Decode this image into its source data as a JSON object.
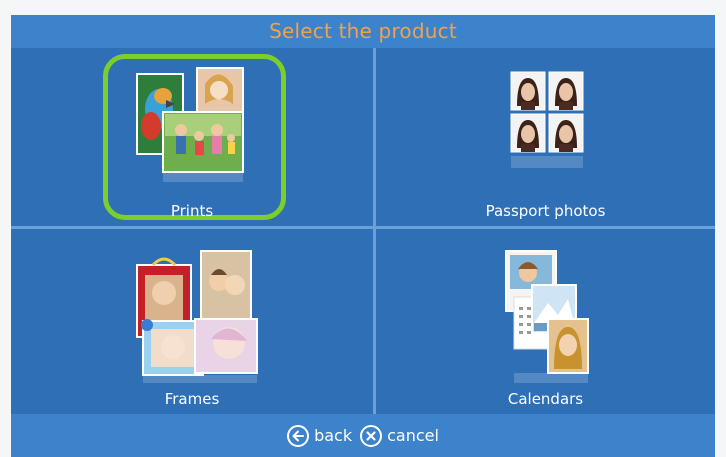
{
  "header": {
    "title": "Select the product",
    "title_color": "#f0a24a"
  },
  "tiles": [
    {
      "label": "Prints",
      "icon": "prints-collage-icon",
      "selected": true
    },
    {
      "label": "Passport photos",
      "icon": "passport-photos-icon",
      "selected": false
    },
    {
      "label": "Frames",
      "icon": "frames-collage-icon",
      "selected": false
    },
    {
      "label": "Calendars",
      "icon": "calendars-collage-icon",
      "selected": false
    }
  ],
  "footer": {
    "back_label": "back",
    "back_icon": "arrow-left-circle-icon",
    "cancel_label": "cancel",
    "cancel_icon": "x-circle-icon"
  },
  "colors": {
    "tile_bg": "#2f6fb6",
    "bar_bg": "#3d83cb",
    "selection": "#7ccf2a"
  }
}
